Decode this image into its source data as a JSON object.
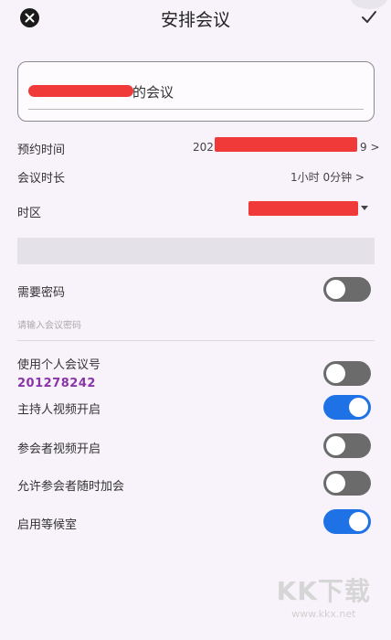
{
  "header": {
    "title": "安排会议",
    "close_icon": "close-icon",
    "confirm_icon": "checkmark-icon"
  },
  "topic": {
    "suffix": "的会议"
  },
  "schedule": {
    "time_label": "预约时间",
    "time_value_prefix": "202",
    "time_value_suffix": "9 >",
    "duration_label": "会议时长",
    "duration_value": "1小时 0分钟 >",
    "timezone_label": "时区"
  },
  "password": {
    "label": "需要密码",
    "enabled": false,
    "placeholder": "请输入会议密码"
  },
  "options": {
    "personal_id_label": "使用个人会议号",
    "personal_id_value": "201278242",
    "personal_id_enabled": false,
    "host_video_label": "主持人视频开启",
    "host_video_enabled": true,
    "participant_video_label": "参会者视频开启",
    "participant_video_enabled": false,
    "join_anytime_label": "允许参会者随时加会",
    "join_anytime_enabled": false,
    "waiting_room_label": "启用等候室",
    "waiting_room_enabled": true
  },
  "colors": {
    "accent": "#1f72e6",
    "meeting_id": "#8b34a8",
    "redaction": "#f03a3a"
  },
  "watermark": {
    "logo_text": "KK下载",
    "url": "www.kkx.net"
  }
}
